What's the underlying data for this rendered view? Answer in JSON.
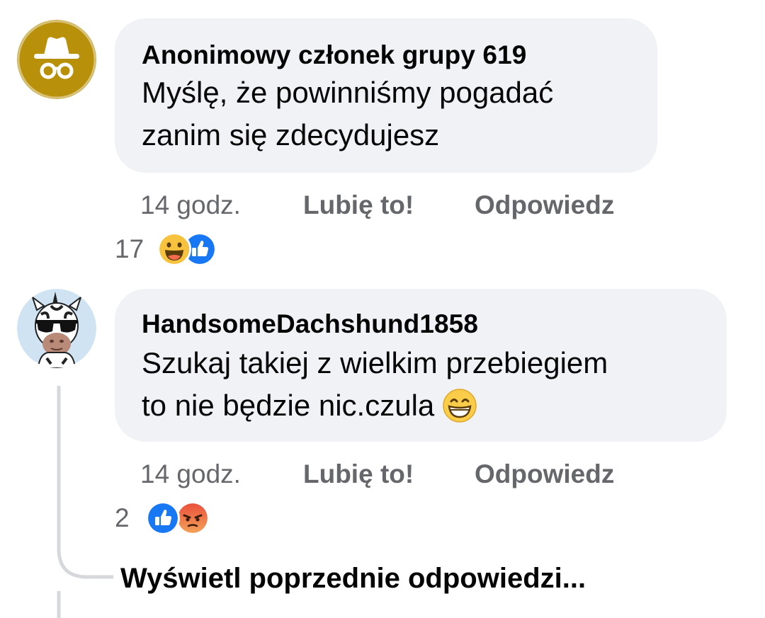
{
  "comments": [
    {
      "author": "Anonimowy członek grupy 619",
      "avatar_icon": "anonymous-member-icon",
      "text_lines": [
        "Myślę, że powinniśmy pogadać",
        "zanim się zdecydujesz"
      ],
      "time": "14 godz.",
      "like_label": "Lubię to!",
      "reply_label": "Odpowiedz",
      "reaction_count": "17",
      "reactions": [
        "haha-reaction-icon",
        "like-reaction-icon"
      ]
    },
    {
      "author": "HandsomeDachshund1858",
      "avatar_icon": "zebra-sunglasses-avatar-icon",
      "text_lines": [
        "Szukaj takiej z wielkim przebiegiem",
        "to nie będzie nic.czula"
      ],
      "inline_emoji": "grinning-emoji-icon",
      "time": "14 godz.",
      "like_label": "Lubię to!",
      "reply_label": "Odpowiedz",
      "reaction_count": "2",
      "reactions": [
        "like-reaction-icon",
        "angry-reaction-icon"
      ]
    }
  ],
  "view_previous_replies": "Wyświetl poprzednie odpowiedzi...",
  "colors": {
    "bubble": "#f0f2f5",
    "meta_text": "#65676b",
    "primary_text": "#050505",
    "anonymous_avatar": "#b8900a",
    "like_blue": "#1877f2",
    "angry_red": "#e9503b",
    "haha_yellow": "#f7c23d"
  }
}
